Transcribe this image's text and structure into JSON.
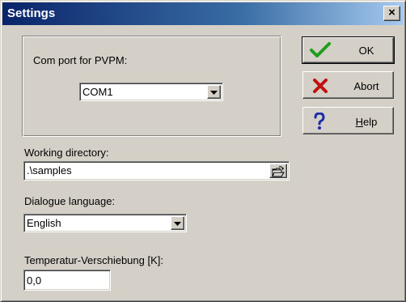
{
  "window": {
    "title": "Settings",
    "close_label": "×"
  },
  "com_port": {
    "label": "Com port for PVPM:",
    "value": "COM1"
  },
  "working_directory": {
    "label": "Working directory:",
    "value": ".\\samples"
  },
  "language": {
    "label": "Dialogue language:",
    "value": "English"
  },
  "temperature": {
    "label": "Temperatur-Verschiebung [K]:",
    "value": "0,0"
  },
  "buttons": {
    "ok": {
      "label": "OK",
      "icon": "checkmark-icon",
      "color": "#1f9d1f"
    },
    "abort": {
      "label": "Abort",
      "icon": "x-icon",
      "color": "#c01010"
    },
    "help": {
      "label_mnemonic": "H",
      "label_rest": "elp",
      "icon": "question-icon",
      "color": "#1b2aa8"
    }
  },
  "colors": {
    "face": "#d4d0c8",
    "title_start": "#0a246a",
    "title_end": "#a6caf0"
  }
}
